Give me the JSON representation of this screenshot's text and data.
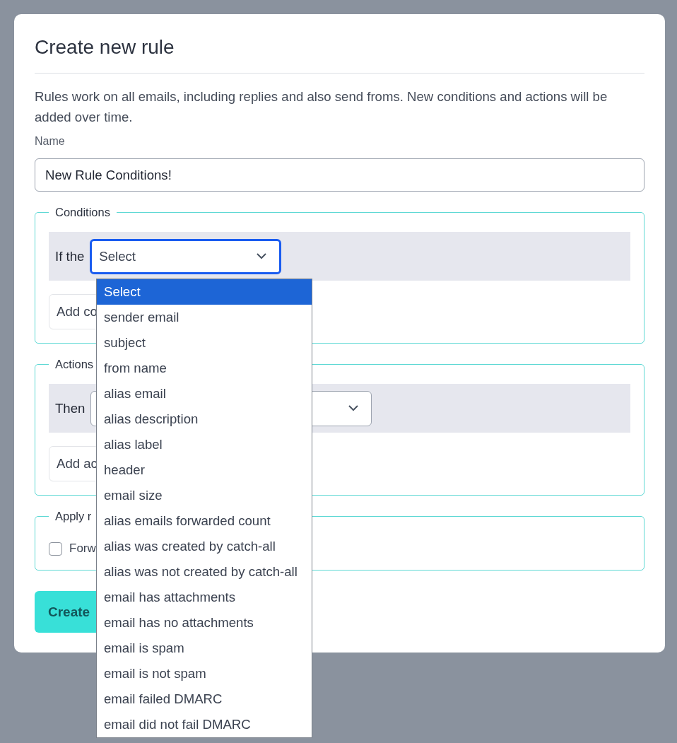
{
  "dialog": {
    "title": "Create new rule",
    "description": "Rules work on all emails, including replies and also send froms. New conditions and actions will be added over time.",
    "name_label": "Name",
    "name_value": "New Rule Conditions!"
  },
  "conditions": {
    "legend": "Conditions",
    "prefix": "If the",
    "select_value": "Select",
    "add_button": "Add co"
  },
  "actions": {
    "legend": "Actions",
    "prefix": "Then",
    "add_button": "Add ac"
  },
  "apply": {
    "legend": "Apply r",
    "checkbox_label": "Forw",
    "checked": false
  },
  "submit_button": "Create",
  "dropdown_options": [
    {
      "label": "Select",
      "selected": true
    },
    {
      "label": "sender email",
      "selected": false
    },
    {
      "label": "subject",
      "selected": false
    },
    {
      "label": "from name",
      "selected": false
    },
    {
      "label": "alias email",
      "selected": false
    },
    {
      "label": "alias description",
      "selected": false
    },
    {
      "label": "alias label",
      "selected": false
    },
    {
      "label": "header",
      "selected": false
    },
    {
      "label": "email size",
      "selected": false
    },
    {
      "label": "alias emails forwarded count",
      "selected": false
    },
    {
      "label": "alias was created by catch-all",
      "selected": false
    },
    {
      "label": "alias was not created by catch-all",
      "selected": false
    },
    {
      "label": "email has attachments",
      "selected": false
    },
    {
      "label": "email has no attachments",
      "selected": false
    },
    {
      "label": "email is spam",
      "selected": false
    },
    {
      "label": "email is not spam",
      "selected": false
    },
    {
      "label": "email failed DMARC",
      "selected": false
    },
    {
      "label": "email did not fail DMARC",
      "selected": false
    }
  ]
}
